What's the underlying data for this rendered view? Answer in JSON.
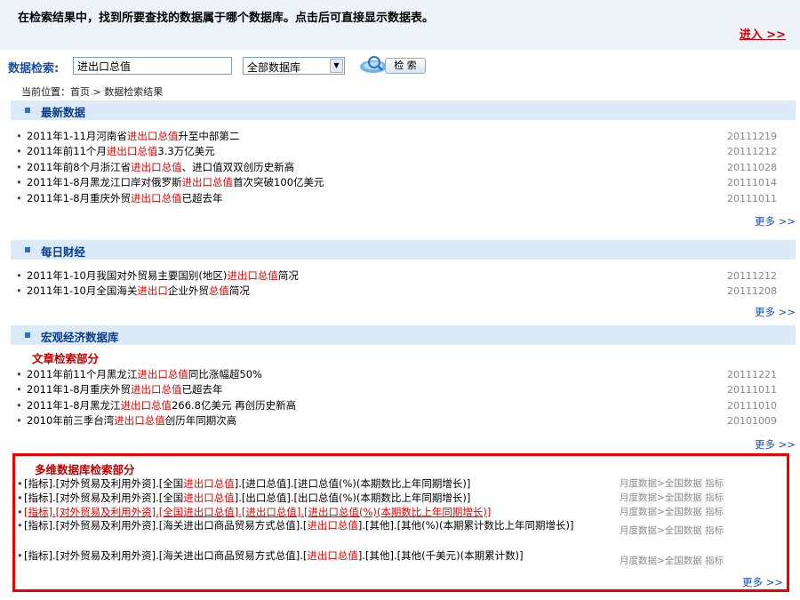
{
  "notice": "在检索结果中，找到所要查找的数据属于哪个数据库。点击后可直接显示数据表。",
  "enter_link": "进入 >>",
  "search": {
    "label": "数据检索:",
    "value": "进出口总值",
    "db_select": "全部数据库",
    "button": "检 索"
  },
  "breadcrumb": "当前位置：首页 > 数据检索结果",
  "sections": {
    "latest": {
      "title": "最新数据",
      "more": "更多 >>",
      "items": [
        {
          "pre": "2011年1-11月河南省",
          "hl": "进出口总值",
          "post": "升至中部第二",
          "date": "20111219"
        },
        {
          "pre": "2011年前11个月",
          "hl": "进出口总值",
          "post": "3.3万亿美元",
          "date": "20111212"
        },
        {
          "pre": "2011年前8个月浙江省",
          "hl": "进出口总值",
          "post": "、进口值双双创历史新高",
          "date": "20111028"
        },
        {
          "pre": "2011年1-8月黑龙江口岸对俄罗斯",
          "hl": "进出口总值",
          "post": "首次突破100亿美元",
          "date": "20111014"
        },
        {
          "pre": "2011年1-8月重庆外贸",
          "hl": "进出口总值",
          "post": "已超去年",
          "date": "20111011"
        }
      ]
    },
    "daily": {
      "title": "每日财经",
      "more": "更多 >>",
      "items": [
        {
          "pre": "2011年1-10月我国对外贸易主要国别(地区)",
          "hl": "进出口总值",
          "post": "简况",
          "date": "20111212"
        },
        {
          "pre": "2011年1-10月全国海关",
          "hl": "进出口",
          "post": "企业外贸",
          "hl2": "总值",
          "post2": "简况",
          "date": "20111208"
        }
      ]
    },
    "macro": {
      "title": "宏观经济数据库",
      "sub_title": "文章检索部分",
      "more": "更多 >>",
      "items": [
        {
          "pre": "2011年前11个月黑龙江",
          "hl": "进出口总值",
          "post": "同比涨幅超50%",
          "date": "20111221"
        },
        {
          "pre": "2011年1-8月重庆外贸",
          "hl": "进出口总值",
          "post": "已超去年",
          "date": "20111011"
        },
        {
          "pre": "2011年1-8月黑龙江",
          "hl": "进出口总值",
          "post": "266.8亿美元 再创历史新高",
          "date": "20111010"
        },
        {
          "pre": "2010年前三季台湾",
          "hl": "进出口总值",
          "post": "创历年同期次高",
          "date": "20101009"
        }
      ]
    },
    "multidim": {
      "title": "多维数据库检索部分",
      "more": "更多 >>",
      "items": [
        {
          "a": "[指标].[对外贸易及利用外资].[全国",
          "hl": "进出口总值",
          "b": "].[进口总值].[进口总值(%)(本期数比上年同期增长)]",
          "cat": "月度数据>全国数据 指标"
        },
        {
          "a": "[指标].[对外贸易及利用外资].[全国",
          "hl": "进出口总值",
          "b": "].[出口总值].[出口总值(%)(本期数比上年同期增长)]",
          "cat": "月度数据>全国数据 指标"
        },
        {
          "a": "[指标].[对外贸易及利用外资].[全国",
          "hl": "进出口总值",
          "b": "].[进出口总值].[进出口总值(%)(本期数比上年同期增长)]",
          "cat": "月度数据>全国数据 指标"
        },
        {
          "a": "[指标].[对外贸易及利用外资].[海关进出口商品贸易方式总值].[",
          "hl": "进出口总值",
          "b": "].[其他].[其他(%)(本期累计数比上年同期增长)]",
          "cat": "月度数据>全国数据 指标"
        },
        {
          "a": "[指标].[对外贸易及利用外资].[海关进出口商品贸易方式总值].[",
          "hl": "进出口总值",
          "b": "].[其他].[其他(千美元)(本期累计数)]",
          "cat": "月度数据>全国数据 指标"
        }
      ]
    }
  }
}
